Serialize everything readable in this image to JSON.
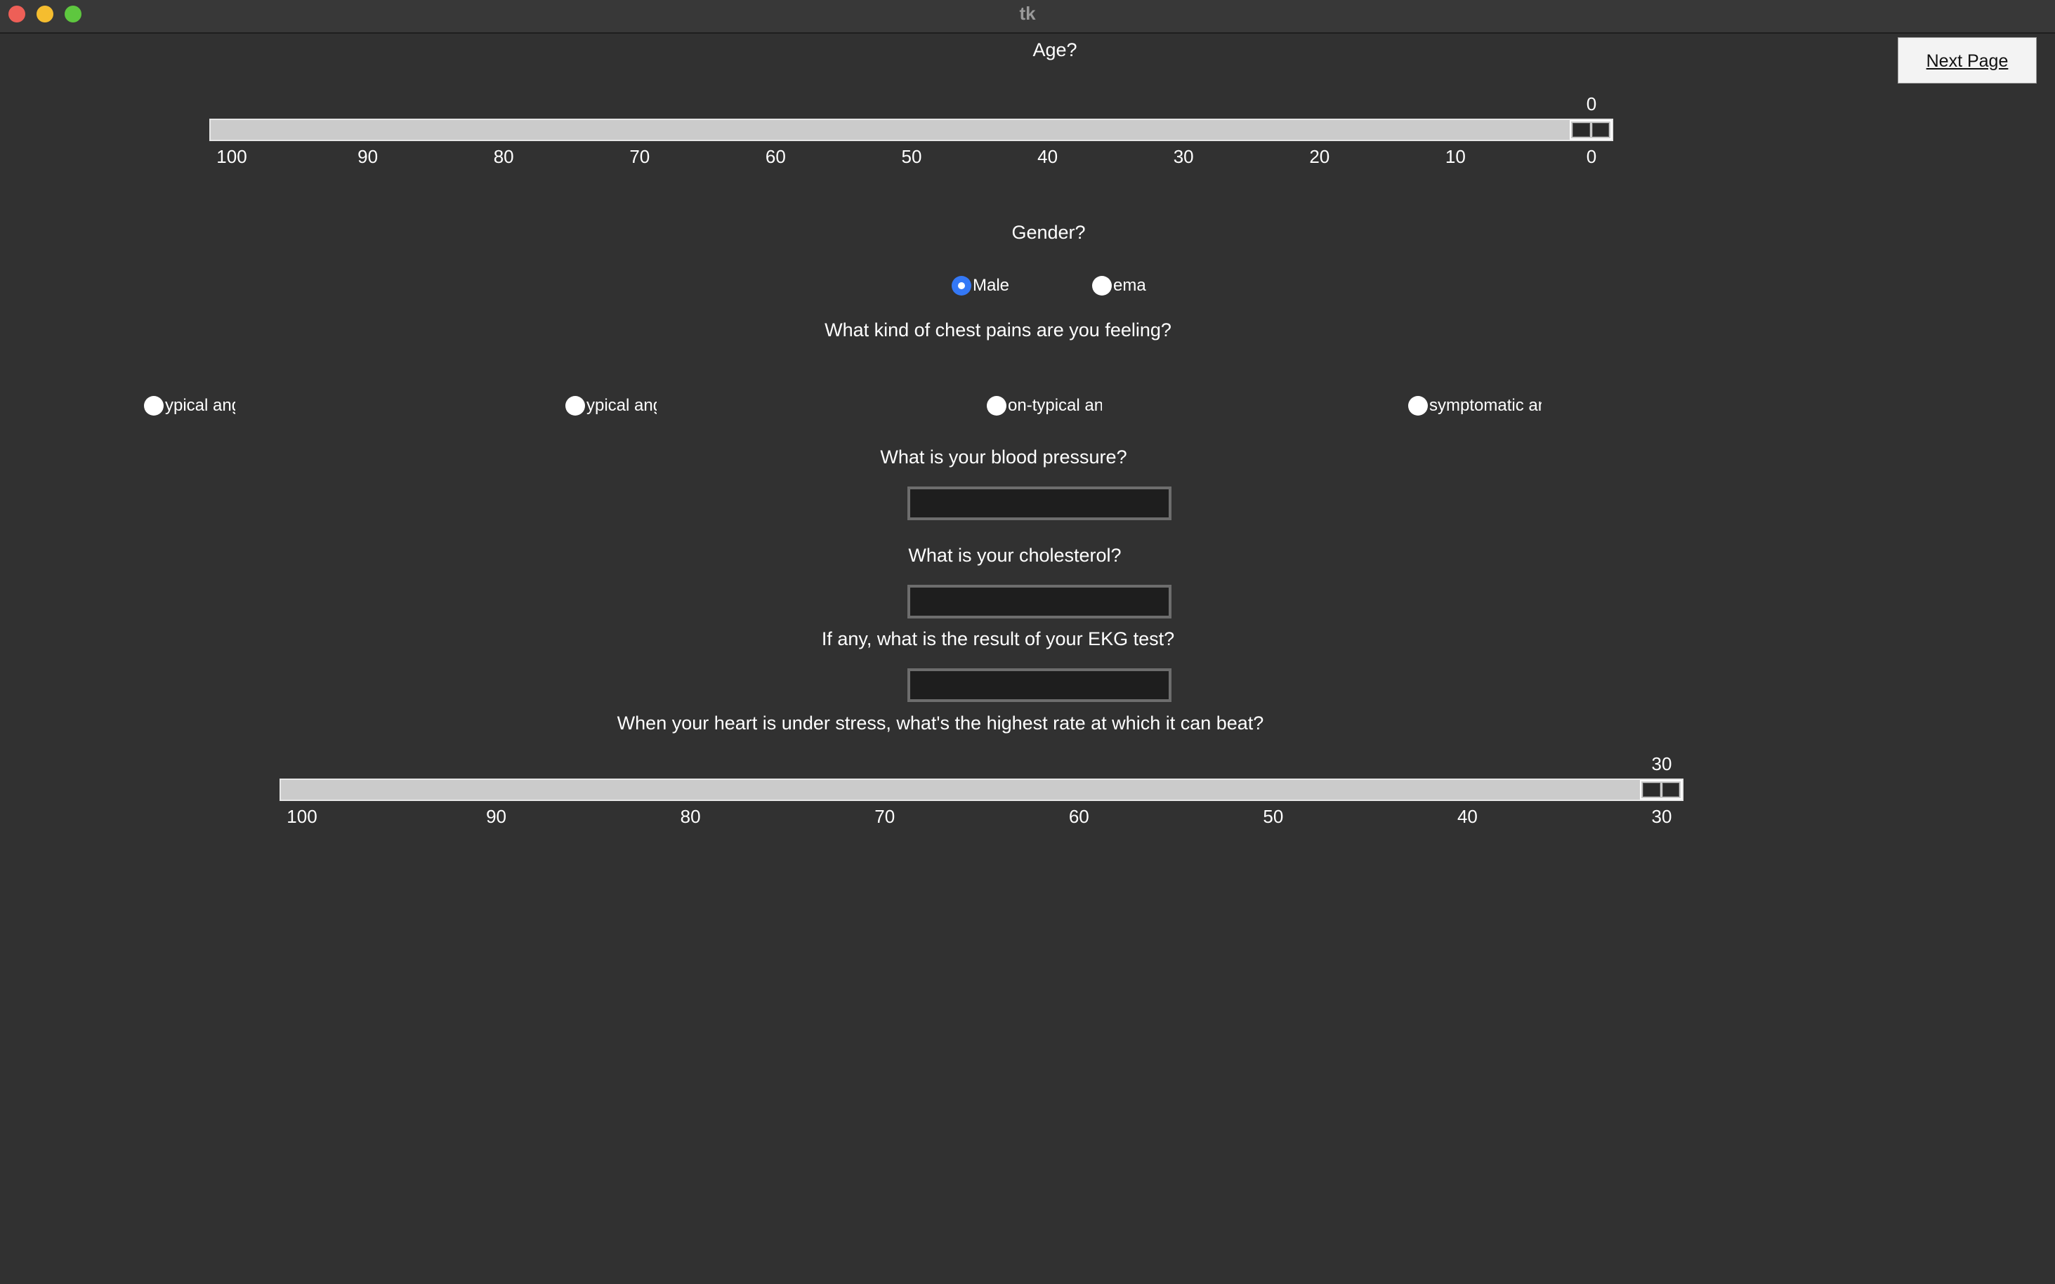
{
  "window": {
    "title": "tk"
  },
  "next_button": {
    "label": "Next Page"
  },
  "age": {
    "question": "Age?",
    "value": "0",
    "min": 0,
    "max": 100,
    "ticks": [
      "100",
      "90",
      "80",
      "70",
      "60",
      "50",
      "40",
      "30",
      "20",
      "10",
      "0"
    ]
  },
  "gender": {
    "question": "Gender?",
    "options": [
      {
        "label": "Male",
        "selected": true
      },
      {
        "label": "emal",
        "selected": false
      }
    ]
  },
  "chest_pain": {
    "question": "What kind of chest pains are you feeling?",
    "options": [
      {
        "label": "ypical angin",
        "selected": false
      },
      {
        "label": "ypical angi",
        "selected": false
      },
      {
        "label": "on-typical angir",
        "selected": false
      },
      {
        "label": "symptomatic angir",
        "selected": false
      }
    ]
  },
  "blood_pressure": {
    "question": "What is your blood pressure?",
    "value": ""
  },
  "cholesterol": {
    "question": "What is your cholesterol?",
    "value": ""
  },
  "ekg": {
    "question": "If any, what is the result of your EKG test?",
    "value": ""
  },
  "max_heart_rate": {
    "question": "When your heart is under stress, what's the highest rate at which it can beat?",
    "value": "30",
    "min": 30,
    "max": 100,
    "ticks": [
      "100",
      "90",
      "80",
      "70",
      "60",
      "50",
      "40",
      "30"
    ]
  }
}
